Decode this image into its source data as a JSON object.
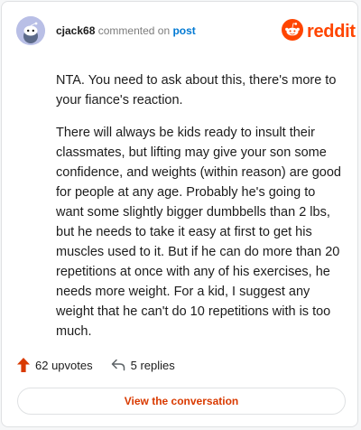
{
  "header": {
    "username": "cjack68",
    "action_text": "commented on",
    "post_link": "post",
    "brand": "reddit"
  },
  "comment": {
    "paragraphs": [
      "NTA. You need to ask about this, there's more to your fiance's reaction.",
      "There will always be kids ready to insult their classmates, but lifting may give your son some confidence, and weights (within reason) are good for people at any age. Probably he's going to want some slightly bigger dumbbells than 2 lbs, but he needs to take it easy at first to get his muscles used to it. But if he can do more than 20 repetitions at once with any of his exercises, he needs more weight. For a kid, I suggest any weight that he can't do 10 repetitions with is too much."
    ]
  },
  "footer": {
    "upvotes": "62 upvotes",
    "replies": "5 replies",
    "cta": "View the conversation"
  },
  "icons": {
    "avatar": "snoo-avatar-icon",
    "brand": "reddit-logo-icon",
    "upvote": "upvote-arrow-icon",
    "reply": "reply-arrow-icon"
  },
  "colors": {
    "brand": "#ff4500",
    "link": "#0079d3",
    "cta": "#d93a00",
    "avatar_bg": "#b9bfe6"
  }
}
